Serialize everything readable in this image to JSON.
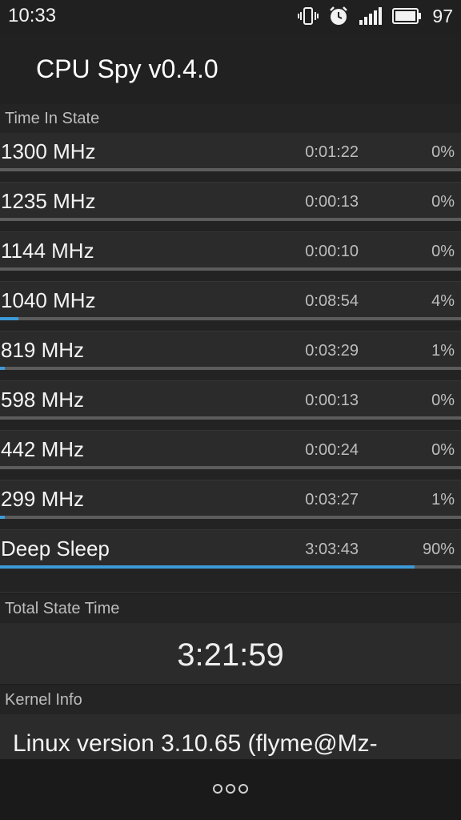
{
  "status_bar": {
    "time": "10:33",
    "battery_level": "97",
    "icons": [
      "vibrate-icon",
      "alarm-icon",
      "signal-icon",
      "battery-icon"
    ]
  },
  "app_bar": {
    "title": "CPU Spy v0.4.0"
  },
  "time_in_state": {
    "header": "Time In State",
    "states": [
      {
        "label": "1300 MHz",
        "time": "0:01:22",
        "percent": "0%",
        "fraction": 0.0
      },
      {
        "label": "1235 MHz",
        "time": "0:00:13",
        "percent": "0%",
        "fraction": 0.0
      },
      {
        "label": "1144 MHz",
        "time": "0:00:10",
        "percent": "0%",
        "fraction": 0.0
      },
      {
        "label": "1040 MHz",
        "time": "0:08:54",
        "percent": "4%",
        "fraction": 0.04
      },
      {
        "label": "819 MHz",
        "time": "0:03:29",
        "percent": "1%",
        "fraction": 0.01
      },
      {
        "label": "598 MHz",
        "time": "0:00:13",
        "percent": "0%",
        "fraction": 0.0
      },
      {
        "label": "442 MHz",
        "time": "0:00:24",
        "percent": "0%",
        "fraction": 0.0
      },
      {
        "label": "299 MHz",
        "time": "0:03:27",
        "percent": "1%",
        "fraction": 0.01
      },
      {
        "label": "Deep Sleep",
        "time": "3:03:43",
        "percent": "90%",
        "fraction": 0.9
      }
    ]
  },
  "total_state_time": {
    "header": "Total State Time",
    "value": "3:21:59"
  },
  "kernel_info": {
    "header": "Kernel Info",
    "text": "Linux version 3.10.65 (flyme@Mz-"
  },
  "colors": {
    "accent": "#3d9ad8",
    "background": "#1f1f1f",
    "row": "#2b2b2b"
  }
}
